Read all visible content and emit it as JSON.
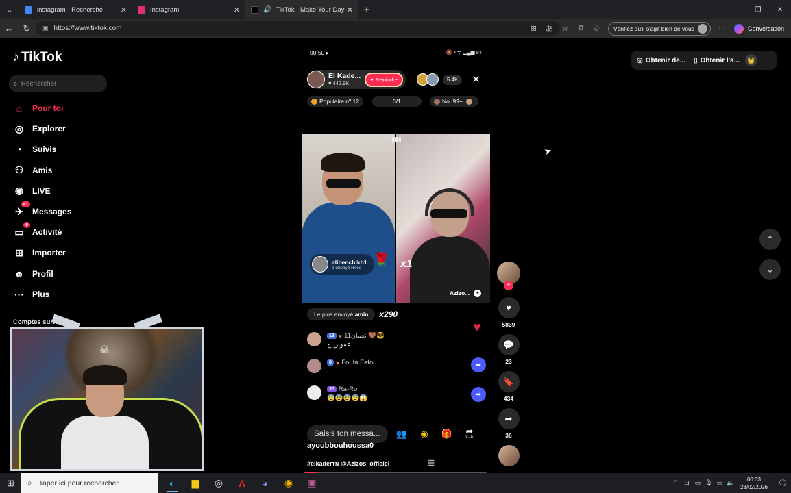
{
  "browser": {
    "tabs": [
      {
        "title": "instagram - Recherche",
        "color": "#4285f4",
        "active": false
      },
      {
        "title": "Instagram",
        "color": "#e1306c",
        "active": false
      },
      {
        "title": "TikTok - Make Your Day",
        "color": "#000000",
        "active": true
      }
    ],
    "url": "https://www.tiktok.com",
    "verify_label": "Vérifiez qu'il s'agit bien de vous",
    "conversation_label": "Conversation"
  },
  "sidebar": {
    "logo": "TikTok",
    "search_placeholder": "Rechercher",
    "items": [
      {
        "label": "Pour toi",
        "icon": "⌂",
        "badge": ""
      },
      {
        "label": "Explorer",
        "icon": "◎",
        "badge": ""
      },
      {
        "label": "Suivis",
        "icon": "◔",
        "badge": ""
      },
      {
        "label": "Amis",
        "icon": "⚇",
        "badge": ""
      },
      {
        "label": "LIVE",
        "icon": "◉",
        "badge": ""
      },
      {
        "label": "Messages",
        "icon": "✈",
        "badge": "41"
      },
      {
        "label": "Activité",
        "icon": "▭",
        "badge": "6"
      },
      {
        "label": "Importer",
        "icon": "⊞",
        "badge": ""
      },
      {
        "label": "Profil",
        "icon": "☻",
        "badge": ""
      },
      {
        "label": "Plus",
        "icon": "···",
        "badge": ""
      }
    ],
    "following_title": "Comptes suivis"
  },
  "live": {
    "status_time": "00:50",
    "status_battery": "84",
    "host_name": "El Kade...",
    "host_likes": "♥ 442.9K",
    "join_label": "Rejoindre",
    "viewer_count": "5.4K",
    "popular_label": "Populaire nº 12",
    "counter": "0/1",
    "rank_label": "No. 99+",
    "gift_sender": "alibenchikh1",
    "gift_sub": "a envoyé Rose",
    "gift_multiplier": "x1",
    "guest_name": "Azizo...",
    "most_sent_prefix": "Le plus envoyé",
    "most_sent_user": "amin",
    "most_sent_count": "x290",
    "comments": [
      {
        "level": "13",
        "name": "نعمان11 🤎😎",
        "text": "عمو رياح",
        "avatar": "#c9a38f",
        "level_class": "blue"
      },
      {
        "level": "8",
        "name": "Foufa Fafou",
        "text": ".",
        "avatar": "#b38a8a",
        "level_class": "blue"
      },
      {
        "level": "30",
        "name": "Ra-Ro",
        "text": "😨😨😨😨😱",
        "avatar": "#eeeeee",
        "level_class": "purple"
      }
    ],
    "input_placeholder": "Saisis ton messa...",
    "share_count": "9.1K",
    "username": "ayoubbouhoussa0",
    "hashtags": "#elkaderᴛɴ @Azizos_officiel",
    "progress_fraction": 0.07
  },
  "actions": {
    "likes": "5839",
    "comments": "23",
    "saves": "434",
    "shares": "36"
  },
  "top_right": {
    "coins_label": "Obtenir de...",
    "app_label": "Obtenir l'a..."
  },
  "taskbar": {
    "search_placeholder": "Taper ici pour rechercher",
    "time": "00:33",
    "date": "28/02/2026"
  }
}
